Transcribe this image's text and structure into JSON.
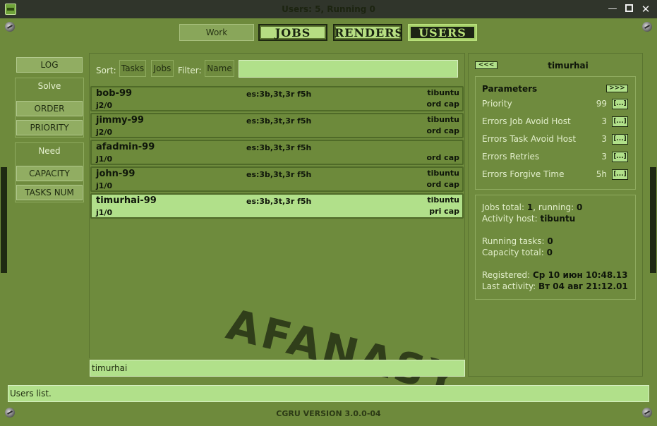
{
  "window": {
    "title": "Users: 5, Running 0",
    "minimize_glyph": "—",
    "close_glyph": "✕"
  },
  "tabs": {
    "work": "Work",
    "jobs": "JOBS",
    "renders": "RENDERS",
    "users": "USERS",
    "active": "users"
  },
  "left_panel": {
    "log": "LOG",
    "solve_title": "Solve",
    "order": "ORDER",
    "priority": "PRIORITY",
    "need_title": "Need",
    "capacity": "CAPACITY",
    "tasks_num": "TASKS NUM"
  },
  "toolbar": {
    "sort_label": "Sort:",
    "sort_tasks": "Tasks",
    "sort_jobs": "Jobs",
    "filter_label": "Filter:",
    "filter_name": "Name",
    "filter_value": ""
  },
  "users": [
    {
      "name": "bob-99",
      "jobs": "j2/0",
      "stats": "es:3b,3t,3r f5h",
      "host": "tibuntu",
      "solve": "ord cap",
      "selected": false
    },
    {
      "name": "jimmy-99",
      "jobs": "j2/0",
      "stats": "es:3b,3t,3r f5h",
      "host": "tibuntu",
      "solve": "ord cap",
      "selected": false
    },
    {
      "name": "afadmin-99",
      "jobs": "j1/0",
      "stats": "es:3b,3t,3r f5h",
      "host": "",
      "solve": "ord cap",
      "selected": false
    },
    {
      "name": "john-99",
      "jobs": "j1/0",
      "stats": "es:3b,3t,3r f5h",
      "host": "tibuntu",
      "solve": "ord cap",
      "selected": false
    },
    {
      "name": "timurhai-99",
      "jobs": "j1/0",
      "stats": "es:3b,3t,3r f5h",
      "host": "tibuntu",
      "solve": "pri cap",
      "selected": true
    }
  ],
  "logo_text": "AFANASY",
  "bottom_input": "timurhai",
  "right_panel": {
    "prev": "<<<",
    "next": ">>>",
    "user": "timurhai",
    "params_title": "Parameters",
    "params": [
      {
        "label": "Priority",
        "value": "99",
        "button": "[...]"
      },
      {
        "label": "Errors Job  Avoid Host",
        "value": "3",
        "button": "[...]"
      },
      {
        "label": "Errors Task Avoid Host",
        "value": "3",
        "button": "[...]"
      },
      {
        "label": "Errors Retries",
        "value": "3",
        "button": "[...]"
      },
      {
        "label": "Errors Forgive Time",
        "value": "5h",
        "button": "[...]"
      }
    ],
    "info": {
      "jobs_total_label": "Jobs total: ",
      "jobs_total": "1",
      "running_label": ", running: ",
      "running": "0",
      "activity_host_label": "Activity host: ",
      "activity_host": "tibuntu",
      "running_tasks_label": "Running tasks: ",
      "running_tasks": "0",
      "capacity_total_label": "Capacity total: ",
      "capacity_total": "0",
      "registered_label": "Registered: ",
      "registered": "Ср 10 июн 10:48.13",
      "last_activity_label": "Last activity: ",
      "last_activity": "Вт 04 авг 21:12.01"
    }
  },
  "status": "Users list.",
  "version": "CGRU VERSION 3.0.0-04"
}
